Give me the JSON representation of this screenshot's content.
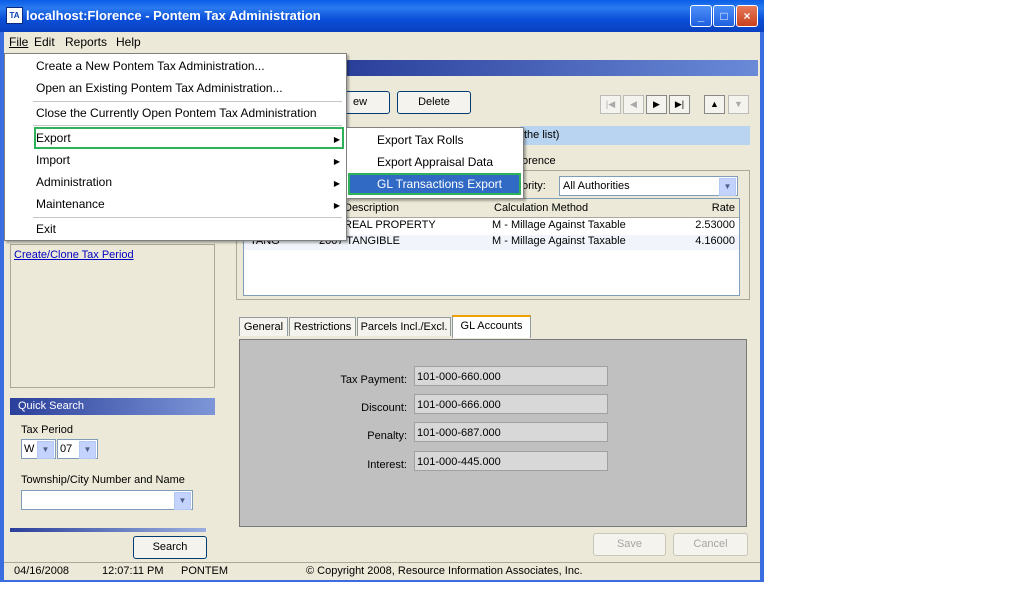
{
  "window": {
    "title": "localhost:Florence - Pontem Tax Administration",
    "icon_text": "TA",
    "min": "_",
    "max": "□",
    "close": "×"
  },
  "menubar": {
    "file": "File",
    "edit": "Edit",
    "reports": "Reports",
    "help": "Help"
  },
  "file_menu": {
    "items": [
      "Create a New Pontem Tax Administration...",
      "Open an Existing Pontem Tax Administration...",
      "Close the Currently Open Pontem Tax Administration",
      "Export",
      "Import",
      "Administration",
      "Maintenance",
      "Exit"
    ]
  },
  "export_submenu": {
    "items": [
      "Export Tax Rolls",
      "Export Appraisal Data",
      "GL Transactions Export"
    ]
  },
  "toolbar": {
    "new_label": "ew",
    "delete_label": "Delete"
  },
  "nav": {
    "first": "|◀",
    "prev": "◀",
    "next": "▶",
    "last": "▶|",
    "up": "▲",
    "down": "▼"
  },
  "partial": {
    "list_hint": "the list)",
    "authority_name": "orence",
    "authority_label": "ority:",
    "authority_value": "All Authorities"
  },
  "grid": {
    "headers": [
      "Description",
      "Calculation Method",
      "Rate"
    ],
    "rows": [
      {
        "code": "",
        "description": "REAL PROPERTY",
        "method": "M - Millage Against Taxable",
        "rate": "2.53000"
      },
      {
        "code": "TANG",
        "description": "2007 TANGIBLE",
        "method": "M - Millage Against Taxable",
        "rate": "4.16000"
      }
    ]
  },
  "tabs": [
    "General",
    "Restrictions",
    "Parcels Incl./Excl.",
    "GL Accounts"
  ],
  "gl_accounts": {
    "tax_payment_label": "Tax Payment:",
    "tax_payment": "101-000-660.000",
    "discount_label": "Discount:",
    "discount": "101-000-666.000",
    "penalty_label": "Penalty:",
    "penalty": "101-000-687.000",
    "interest_label": "Interest:",
    "interest": "101-000-445.000"
  },
  "actions": {
    "save": "Save",
    "cancel": "Cancel"
  },
  "left": {
    "create_link": "Create/Clone Tax Period"
  },
  "quick_search": {
    "title": "Quick Search",
    "tax_period_label": "Tax Period",
    "period_type": "W",
    "period_year": "07",
    "township_label": "Township/City Number and Name",
    "township_value": "",
    "search_button": "Search"
  },
  "status": {
    "date": "04/16/2008",
    "time": "12:07:11 PM",
    "user": "PONTEM",
    "copyright": "© Copyright 2008, Resource Information Associates, Inc."
  },
  "colors": {
    "title_bar": "#0a5ee6",
    "highlight_border": "#2fb15a",
    "menu_highlight": "#316ac5"
  }
}
